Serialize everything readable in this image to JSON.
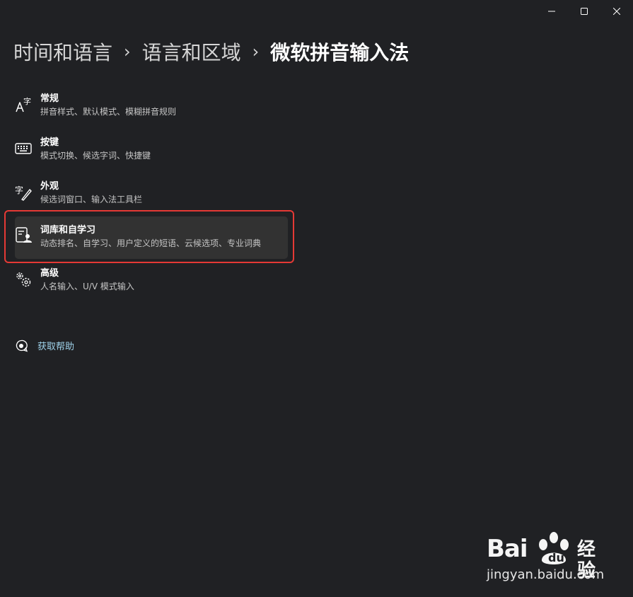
{
  "window_controls": {
    "minimize_icon": "minimize-icon",
    "maximize_icon": "maximize-icon",
    "close_icon": "close-icon"
  },
  "breadcrumb": {
    "items": [
      "时间和语言",
      "语言和区域",
      "微软拼音输入法"
    ],
    "separator": "›"
  },
  "settings": [
    {
      "title": "常规",
      "description": "拼音样式、默认模式、模糊拼音规则",
      "icon": "font-character-icon"
    },
    {
      "title": "按键",
      "description": "模式切换、候选字词、快捷键",
      "icon": "keyboard-icon"
    },
    {
      "title": "外观",
      "description": "候选词窗口、输入法工具栏",
      "icon": "character-pen-icon"
    },
    {
      "title": "词库和自学习",
      "description": "动态排名、自学习、用户定义的短语、云候选项、专业词典",
      "icon": "dictionary-person-icon",
      "selected": true
    },
    {
      "title": "高级",
      "description": "人名输入、U/V 模式输入",
      "icon": "gears-icon"
    }
  ],
  "help": {
    "label": "获取帮助",
    "icon": "help-chat-icon"
  },
  "watermark": {
    "brand": "Bai",
    "brand_suffix": "经验",
    "url": "jingyan.baidu.com"
  },
  "colors": {
    "background": "#202124",
    "selected_item": "#323232",
    "highlight_border": "#e53935",
    "link": "#9fd2ea"
  }
}
